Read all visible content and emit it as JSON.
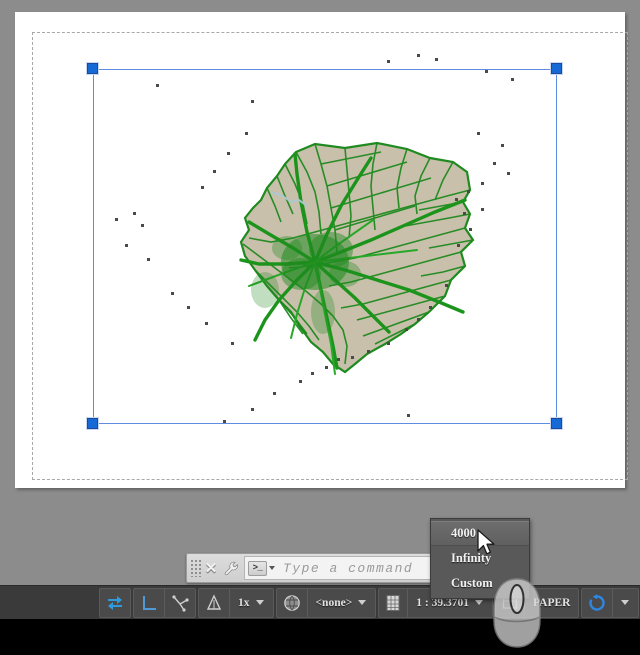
{
  "app": {
    "workspace_bg": "#8c8c8c",
    "paper_bg": "#ffffff",
    "selection_color": "#1769d6"
  },
  "drawing": {
    "title": "cadastral-parcel-map",
    "parcel_fill": "#c9c0ab",
    "boundary_color": "#1f8a1f",
    "stream_color": "#a9c9cf",
    "point_color": "#4a4a4a"
  },
  "selection": {
    "grip_count": 4,
    "grips": [
      "top-left",
      "top-right",
      "bottom-left",
      "bottom-right"
    ]
  },
  "command_bar": {
    "close_label": "✕",
    "settings_icon": "wrench-icon",
    "prompt_glyph": ">_",
    "placeholder": "Type a command",
    "value": ""
  },
  "popup_menu": {
    "name": "annotation-scale-list",
    "items": [
      {
        "label": "4000",
        "selected": true
      },
      {
        "label": "Infinity",
        "selected": false
      },
      {
        "label": "Custom",
        "selected": false
      }
    ]
  },
  "status_bar": {
    "groups": [
      {
        "name": "model-tools",
        "cells": [
          {
            "name": "pan-sync-toggle",
            "icon": "blue-double-arrow-icon",
            "label": ""
          }
        ]
      },
      {
        "name": "ucs-tools",
        "cells": [
          {
            "name": "ucs-icon-toggle",
            "icon": "ucs-axis-icon",
            "label": ""
          },
          {
            "name": "ucs-3d-toggle",
            "icon": "ucs-3d-axis-icon",
            "label": ""
          }
        ]
      },
      {
        "name": "annotation-scale",
        "cells": [
          {
            "name": "annotation-visibility-icon",
            "icon": "annotation-cone-icon",
            "label": ""
          },
          {
            "name": "annotation-scale-value",
            "icon": "",
            "label": "1x",
            "caret": true
          }
        ]
      },
      {
        "name": "workspace-selector",
        "cells": [
          {
            "name": "workspace-globe-icon",
            "icon": "globe-icon",
            "label": ""
          },
          {
            "name": "workspace-value",
            "icon": "",
            "label": "<none>",
            "caret": true
          }
        ]
      },
      {
        "name": "viewport-scale",
        "cells": [
          {
            "name": "viewport-scale-icon",
            "icon": "sheet-icon",
            "label": ""
          },
          {
            "name": "viewport-scale-value",
            "icon": "",
            "label": "1 : 39.3701",
            "caret": true
          }
        ]
      },
      {
        "name": "space-toggle",
        "cells": [
          {
            "name": "paper-space-icon",
            "icon": "paper-icon",
            "label": ""
          },
          {
            "name": "paper-space-label",
            "icon": "",
            "label": "PAPER"
          }
        ]
      },
      {
        "name": "isolate-objects",
        "cells": [
          {
            "name": "refresh-viewport-icon",
            "icon": "blue-circular-arrow-icon",
            "label": "",
            "caret": true
          }
        ]
      },
      {
        "name": "snap-tools",
        "cells": [
          {
            "name": "osnap-toggle-icon",
            "icon": "snap-crossline-icon",
            "label": "",
            "caret": true
          }
        ]
      },
      {
        "name": "angle-tools",
        "cells": [
          {
            "name": "angle-measure-icon",
            "icon": "blue-angle-icon",
            "label": ""
          }
        ]
      }
    ]
  },
  "overlay": {
    "mouse_graphic": "scroll-wheel-mouse-icon",
    "cursor": "arrow-pointer-cursor"
  }
}
